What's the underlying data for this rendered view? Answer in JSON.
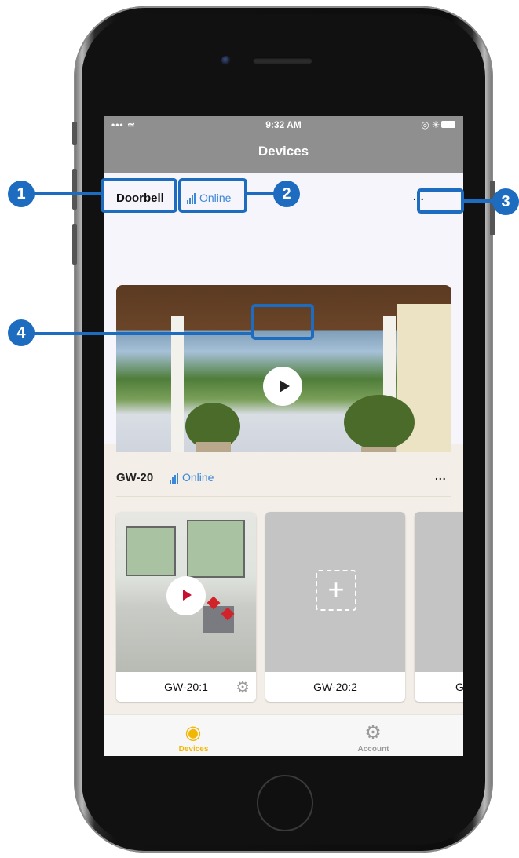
{
  "statusbar": {
    "signal": "••• ≃",
    "time": "9:32 AM",
    "right_icons": "◎ ✳"
  },
  "nav": {
    "title": "Devices"
  },
  "device1": {
    "name": "Doorbell",
    "status": "Online",
    "more": "..."
  },
  "callouts": [
    "1",
    "2",
    "3",
    "4"
  ],
  "device2": {
    "name": "GW-20",
    "status": "Online",
    "more": "...",
    "channels": [
      {
        "label": "GW-20:1"
      },
      {
        "label": "GW-20:2"
      },
      {
        "label": "G"
      }
    ]
  },
  "tabs": [
    {
      "label": "Devices",
      "icon": "camera-icon",
      "active": true,
      "color": "#f2b705"
    },
    {
      "label": "Account",
      "icon": "gear-icon",
      "active": false,
      "color": "#9a9a9a"
    }
  ],
  "colors": {
    "accent_blue": "#1e6cc0",
    "online_blue": "#3b87d8",
    "active_tab": "#f2b705"
  }
}
